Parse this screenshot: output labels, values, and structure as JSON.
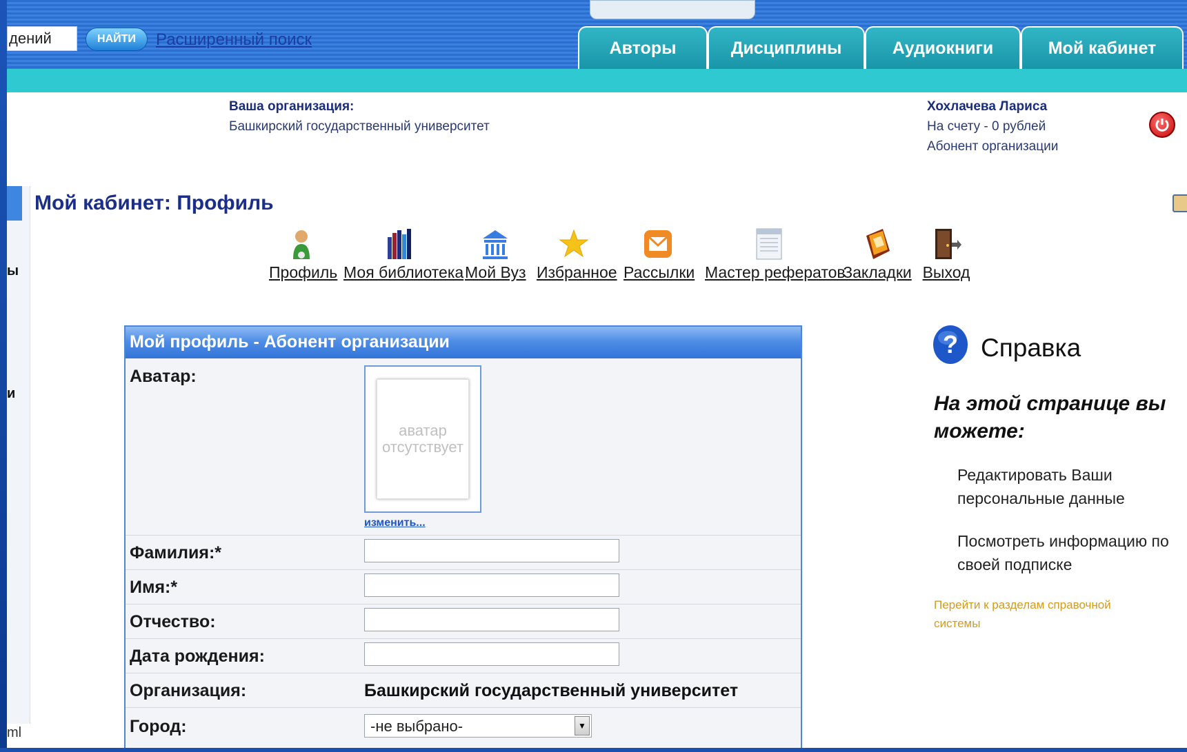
{
  "search": {
    "value": "дений",
    "button_label": "НАЙТИ",
    "advanced_link": "Расширенный поиск"
  },
  "nav": {
    "tabs": [
      {
        "label": "Авторы"
      },
      {
        "label": "Дисциплины"
      },
      {
        "label": "Аудиокниги"
      },
      {
        "label": "Мой кабинет"
      }
    ]
  },
  "org": {
    "label": "Ваша организация:",
    "name": "Башкирский государственный университет"
  },
  "user": {
    "name": "Хохлачева Лариса",
    "balance": "На счету - 0 рублей",
    "role": "Абонент организации"
  },
  "gutter": {
    "text1": "ы",
    "text2": "и",
    "status": "ml"
  },
  "page": {
    "title": "Мой кабинет: Профиль"
  },
  "toolbar": {
    "items": [
      {
        "label": "Профиль",
        "icon": "user-icon"
      },
      {
        "label": "Моя библиотека",
        "icon": "books-icon"
      },
      {
        "label": "Мой Вуз",
        "icon": "university-icon"
      },
      {
        "label": "Избранное",
        "icon": "star-icon"
      },
      {
        "label": "Рассылки",
        "icon": "mail-icon"
      },
      {
        "label": "Мастер рефератов",
        "icon": "document-icon"
      },
      {
        "label": "Закладки",
        "icon": "bookmark-icon"
      },
      {
        "label": "Выход",
        "icon": "exit-door-icon"
      }
    ]
  },
  "form": {
    "header": "Мой профиль - Абонент организации",
    "avatar_label": "Аватар:",
    "avatar_placeholder": "аватар отсутствует",
    "avatar_change": "изменить...",
    "surname_label": "Фамилия:*",
    "name_label": "Имя:*",
    "patronymic_label": "Отчество:",
    "birthdate_label": "Дата рождения:",
    "organization_label": "Организация:",
    "organization_value": "Башкирский государственный университет",
    "city_label": "Город:",
    "city_value": "-не выбрано-"
  },
  "help": {
    "title": "Справка",
    "subtitle": "На этой странице вы можете:",
    "items": [
      "Редактировать Ваши персональные данные",
      "Посмотреть информацию по своей подписке"
    ],
    "link": "Перейти к разделам справочной системы"
  }
}
